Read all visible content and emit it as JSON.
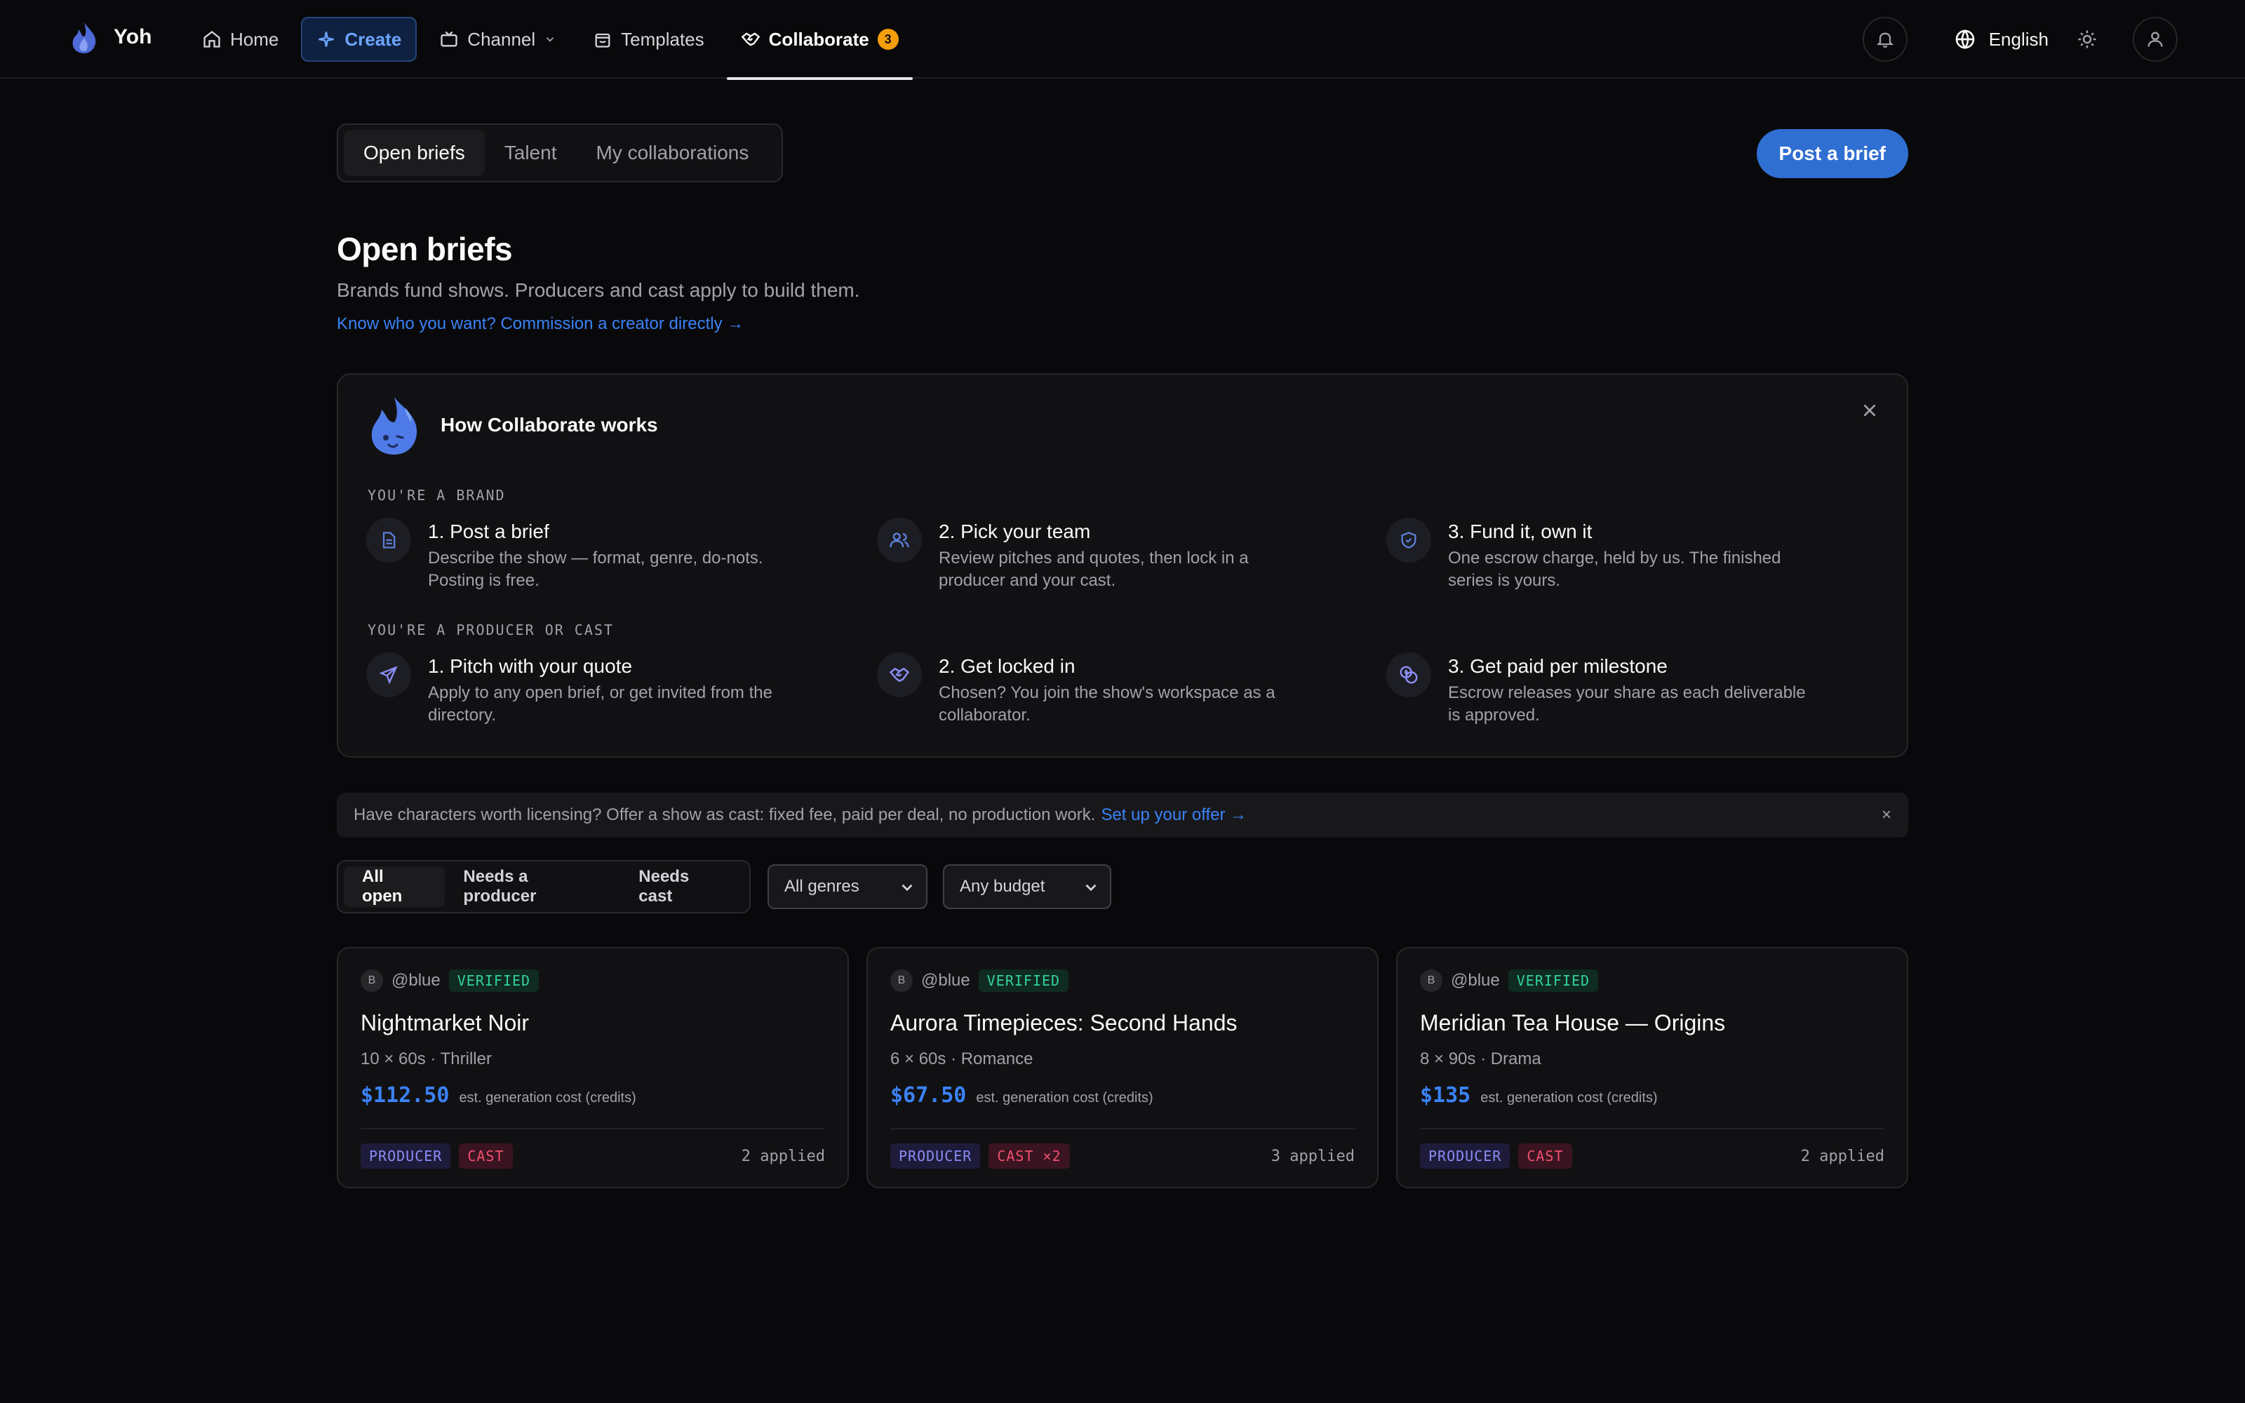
{
  "app": {
    "name": "Yoh"
  },
  "nav": {
    "home": "Home",
    "create": "Create",
    "channel": "Channel",
    "templates": "Templates",
    "collaborate": "Collaborate",
    "collaborate_badge": "3"
  },
  "topright": {
    "language": "English"
  },
  "tabs": [
    "Open briefs",
    "Talent",
    "My collaborations"
  ],
  "post_brief_label": "Post a brief",
  "page": {
    "title": "Open briefs",
    "subtitle": "Brands fund shows. Producers and cast apply to build them.",
    "commission_link": "Know who you want? Commission a creator directly →"
  },
  "how": {
    "title": "How Collaborate works",
    "brand_label": "YOU'RE A BRAND",
    "producer_label": "YOU'RE A PRODUCER OR CAST",
    "brand_steps": [
      {
        "title": "1. Post a brief",
        "desc": "Describe the show — format, genre, do-nots. Posting is free.",
        "icon": "document-icon"
      },
      {
        "title": "2. Pick your team",
        "desc": "Review pitches and quotes, then lock in a producer and your cast.",
        "icon": "users-icon"
      },
      {
        "title": "3. Fund it, own it",
        "desc": "One escrow charge, held by us. The finished series is yours.",
        "icon": "shield-icon"
      }
    ],
    "producer_steps": [
      {
        "title": "1. Pitch with your quote",
        "desc": "Apply to any open brief, or get invited from the directory.",
        "icon": "send-icon"
      },
      {
        "title": "2. Get locked in",
        "desc": "Chosen? You join the show's workspace as a collaborator.",
        "icon": "handshake-icon"
      },
      {
        "title": "3. Get paid per milestone",
        "desc": "Escrow releases your share as each deliverable is approved.",
        "icon": "coins-icon"
      }
    ]
  },
  "banner": {
    "text": "Have characters worth licensing? Offer a show as cast: fixed fee, paid per deal, no production work.",
    "link": "Set up your offer →",
    "close": "×"
  },
  "filters": {
    "segments": [
      "All open",
      "Needs a producer",
      "Needs cast"
    ],
    "genre": "All genres",
    "budget": "Any budget"
  },
  "cards": [
    {
      "avatar": "B",
      "owner": "@blue",
      "verified": "VERIFIED",
      "title": "Nightmarket Noir",
      "meta": "10 × 60s · Thriller",
      "price": "$112.50",
      "price_note": "est. generation cost (credits)",
      "tags": [
        "PRODUCER",
        "CAST"
      ],
      "applied": "2 applied"
    },
    {
      "avatar": "B",
      "owner": "@blue",
      "verified": "VERIFIED",
      "title": "Aurora Timepieces: Second Hands",
      "meta": "6 × 60s · Romance",
      "price": "$67.50",
      "price_note": "est. generation cost (credits)",
      "tags": [
        "PRODUCER",
        "CAST ×2"
      ],
      "applied": "3 applied"
    },
    {
      "avatar": "B",
      "owner": "@blue",
      "verified": "VERIFIED",
      "title": "Meridian Tea House — Origins",
      "meta": "8 × 90s · Drama",
      "price": "$135",
      "price_note": "est. generation cost (credits)",
      "tags": [
        "PRODUCER",
        "CAST"
      ],
      "applied": "2 applied"
    }
  ]
}
